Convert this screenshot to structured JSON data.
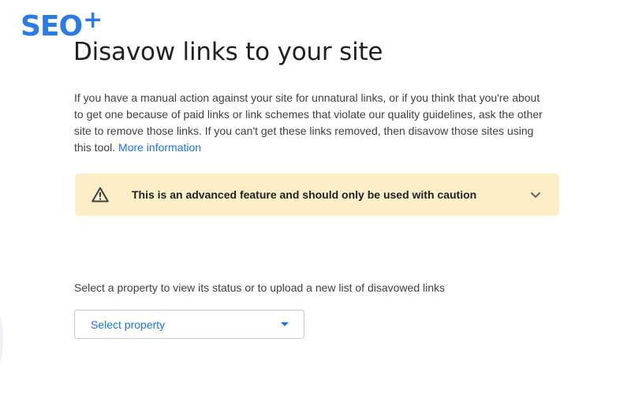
{
  "logo": {
    "text": "SEO",
    "plus": "+"
  },
  "header": {
    "title": "Disavow links to your site"
  },
  "description": {
    "text": "If you have a manual action against your site for unnatural links, or if you think that you're about to get one because of paid links or link schemes that violate our quality guidelines, ask the other site to remove those links. If you can't get these links removed, then disavow those sites using this tool. ",
    "link_label": "More information"
  },
  "warning": {
    "icon": "warning-triangle-icon",
    "text": "This is an advanced feature and should only be used with caution",
    "expand_icon": "chevron-down-icon",
    "background_color": "#fcefc7"
  },
  "property": {
    "prompt": "Select a property to view its status or to upload a new list of disavowed links",
    "select_label": "Select property",
    "arrow_icon": "dropdown-arrow-icon"
  },
  "colors": {
    "accent": "#1a73e8",
    "logo": "#2a7be4",
    "text": "#3c4043",
    "title": "#202124"
  }
}
